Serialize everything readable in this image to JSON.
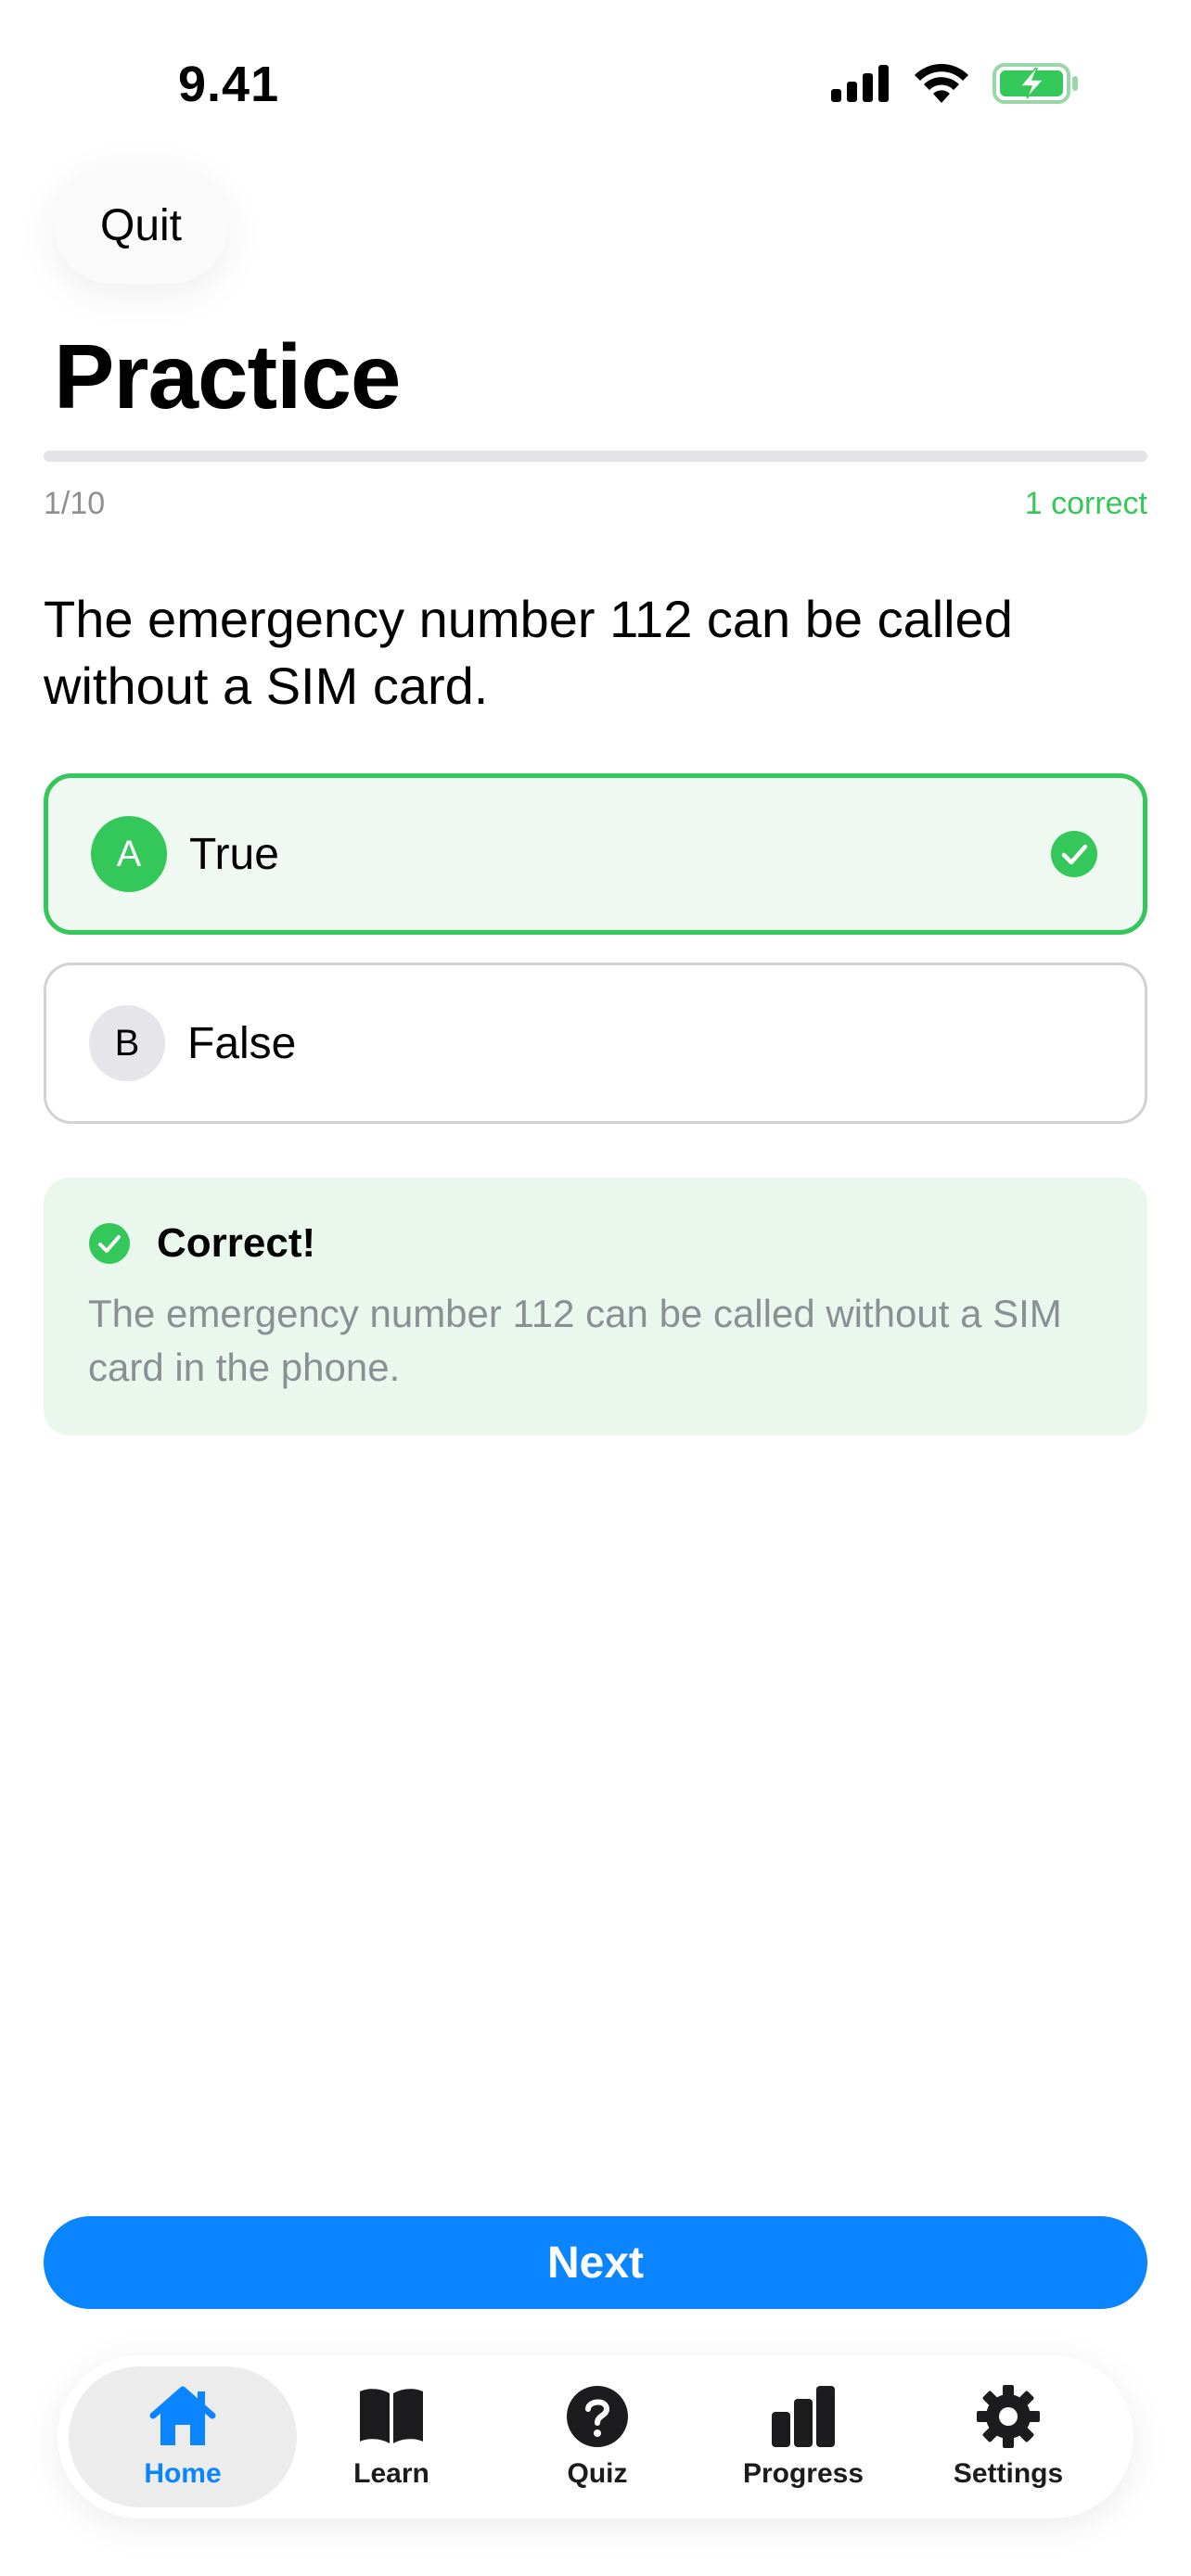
{
  "status_bar": {
    "time": "9.41"
  },
  "header": {
    "quit_label": "Quit",
    "title": "Practice"
  },
  "progress": {
    "current": "1/10",
    "correct_text": "1 correct",
    "fraction": 0.0
  },
  "question": {
    "text": "The emergency number 112 can be called without a SIM card."
  },
  "options": [
    {
      "letter": "A",
      "text": "True",
      "state": "correct-selected"
    },
    {
      "letter": "B",
      "text": "False",
      "state": "unselected"
    }
  ],
  "feedback": {
    "title": "Correct!",
    "text": "The emergency number 112 can be called without a SIM card in the phone."
  },
  "next_label": "Next",
  "tab_bar": {
    "items": [
      {
        "label": "Home",
        "icon": "house-icon",
        "active": true
      },
      {
        "label": "Learn",
        "icon": "book-icon",
        "active": false
      },
      {
        "label": "Quiz",
        "icon": "question-circle-icon",
        "active": false
      },
      {
        "label": "Progress",
        "icon": "bar-chart-icon",
        "active": false
      },
      {
        "label": "Settings",
        "icon": "gear-icon",
        "active": false
      }
    ]
  },
  "colors": {
    "accent": "#0a84ff",
    "success": "#34c759",
    "success_bg": "#e9f7ec"
  }
}
